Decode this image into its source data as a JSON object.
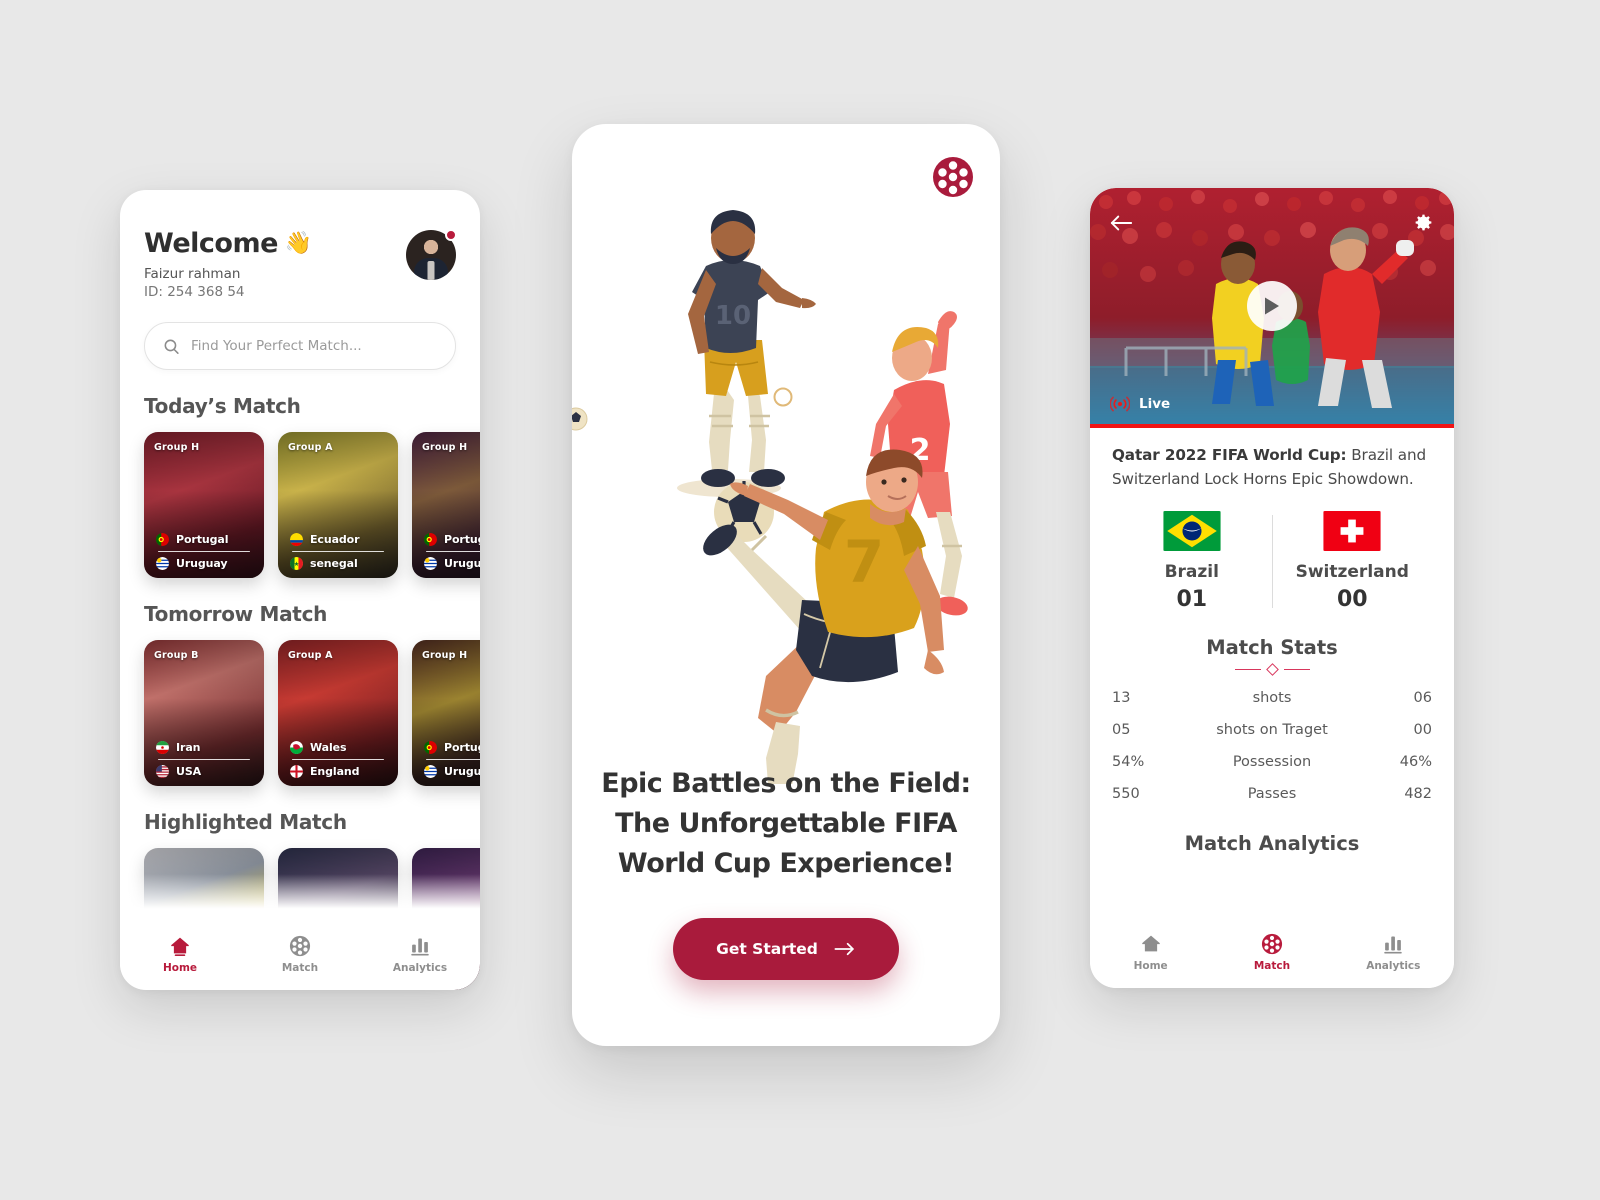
{
  "theme": {
    "background": "#e8e8e8",
    "accent": "#a91b3c",
    "accent_light": "#d8365c",
    "live_red": "#f21414",
    "card_white": "#ffffff"
  },
  "phone1": {
    "header": {
      "welcome_title": "Welcome",
      "wave_icon": "waving-hand",
      "user_name": "Faizur rahman",
      "user_id": "ID: 254 368 54",
      "avatar": "user-avatar",
      "notification_dot": true
    },
    "search": {
      "placeholder": "Find Your Perfect Match...",
      "icon": "search-icon"
    },
    "sections": [
      {
        "title": "Today’s Match",
        "cards": [
          {
            "group": "Group H",
            "team1": "Portugal",
            "team2": "Uruguay",
            "flag1": "pt",
            "flag2": "uy",
            "photo": "ronaldo-portugal"
          },
          {
            "group": "Group A",
            "team1": "Ecuador",
            "team2": "senegal",
            "flag1": "ec",
            "flag2": "sn",
            "photo": "ecuador-13"
          },
          {
            "group": "Group H",
            "team1": "Portugal",
            "team2": "Uruguay",
            "flag1": "pt",
            "flag2": "uy",
            "photo": "ecuador-10"
          }
        ]
      },
      {
        "title": "Tomorrow Match",
        "cards": [
          {
            "group": "Group B",
            "team1": "Iran",
            "team2": "USA",
            "flag1": "ir",
            "flag2": "us",
            "photo": "iran-20"
          },
          {
            "group": "Group A",
            "team1": "Wales",
            "team2": "England",
            "flag1": "wa",
            "flag2": "en",
            "photo": "bale-wales"
          },
          {
            "group": "Group H",
            "team1": "Portugal",
            "team2": "Uruguay",
            "flag1": "pt",
            "flag2": "uy",
            "photo": "ecuador-10b"
          }
        ]
      },
      {
        "title": "Highlighted Match",
        "cards": [
          {
            "group": "",
            "team1": "",
            "team2": "",
            "flag1": "",
            "flag2": "",
            "photo": "brazil-squad"
          },
          {
            "group": "",
            "team1": "",
            "team2": "",
            "flag1": "",
            "flag2": "",
            "photo": "celebration"
          },
          {
            "group": "",
            "team1": "",
            "team2": "",
            "flag1": "",
            "flag2": "",
            "photo": "ronaldo-purple"
          }
        ]
      }
    ],
    "nav": {
      "active": "Home",
      "items": [
        {
          "label": "Home",
          "icon": "home-icon"
        },
        {
          "label": "Match",
          "icon": "ball-icon"
        },
        {
          "label": "Analytics",
          "icon": "bar-chart-icon"
        }
      ]
    }
  },
  "phone2": {
    "logo_icon": "soccer-ball-logo",
    "illustration": "soccer-players-illustration",
    "headline": "Epic Battles on the Field: The Unforgettable FIFA World Cup Experience!",
    "cta": {
      "label": "Get Started",
      "icon": "arrow-right-icon"
    },
    "player_numbers": [
      "10",
      "2",
      "7"
    ]
  },
  "phone3": {
    "video": {
      "back_icon": "arrow-left-icon",
      "settings_icon": "gear-icon",
      "play_icon": "play-icon",
      "live_icon": "live-broadcast-icon",
      "live_label": "Live",
      "thumbnail": "brazil-vs-switzerland-match"
    },
    "match_title_bold": "Qatar 2022 FIFA World Cup:",
    "match_title_rest": " Brazil and Switzerland Lock Horns  Epic Showdown.",
    "teams": [
      {
        "name": "Brazil",
        "score": "01",
        "flag": "br"
      },
      {
        "name": "Switzerland",
        "score": "00",
        "flag": "ch"
      }
    ],
    "stats_heading": "Match Stats",
    "stats": [
      {
        "left": "13",
        "label": "shots",
        "right": "06"
      },
      {
        "left": "05",
        "label": "shots on Traget",
        "right": "00"
      },
      {
        "left": "54%",
        "label": "Possession",
        "right": "46%"
      },
      {
        "left": "550",
        "label": "Passes",
        "right": "482"
      }
    ],
    "analytics_heading": "Match Analytics",
    "nav": {
      "active": "Match",
      "items": [
        {
          "label": "Home",
          "icon": "home-icon"
        },
        {
          "label": "Match",
          "icon": "ball-icon"
        },
        {
          "label": "Analytics",
          "icon": "bar-chart-icon"
        }
      ]
    }
  }
}
